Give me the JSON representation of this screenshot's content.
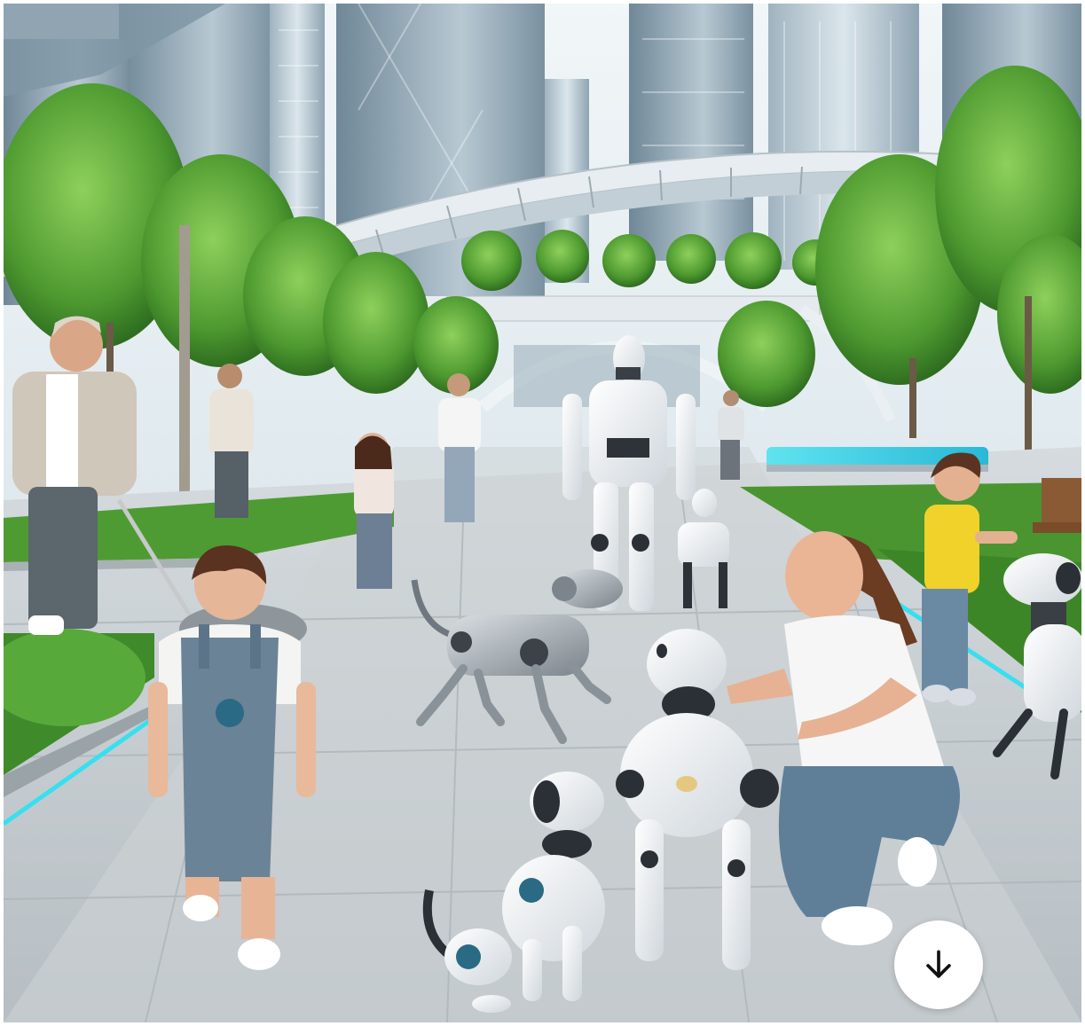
{
  "image": {
    "alt": ""
  },
  "actions": {
    "download": {
      "icon": "arrow-down-icon"
    }
  },
  "colors": {
    "sky": "#e6eef2",
    "pavement": "#b9c1c6",
    "foliage": "#4c9a32",
    "accent_light": "#36e0f0",
    "robot_white": "#f4f6f8",
    "robot_dark": "#2b2f36"
  }
}
